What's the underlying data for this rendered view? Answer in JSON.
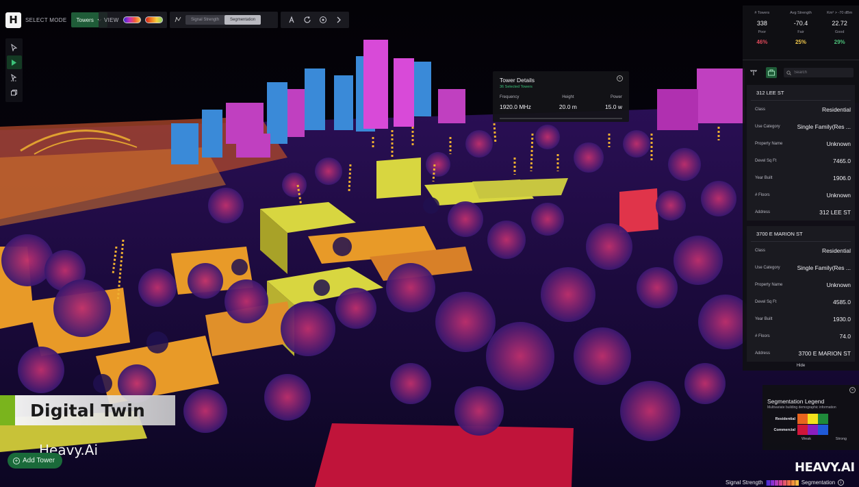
{
  "toolbar": {
    "logo_glyph": "H",
    "select_mode_label": "SELECT MODE",
    "mode_value": "Towers",
    "view_label": "VIEW",
    "segment_options": [
      "Signal Strength",
      "Segmentation"
    ],
    "segment_active": "Segmentation",
    "tool_icons": [
      "paint-brush-icon",
      "refresh-icon",
      "target-icon",
      "chevron-right-icon"
    ]
  },
  "side_tools": [
    "pointer-icon",
    "play-icon",
    "select-path-icon",
    "layers-icon"
  ],
  "tower_details": {
    "title": "Tower Details",
    "subtitle": "36 Selected Towers",
    "frequency_label": "Frequency",
    "frequency_value": "1920.0 MHz",
    "height_label": "Height",
    "height_value": "20.0 m",
    "power_label": "Power",
    "power_value": "15.0 w"
  },
  "stats": {
    "towers_label": "# Towers",
    "towers_value": "338",
    "avg_label": "Avg Strength",
    "avg_value": "-70.4",
    "km_label": "Km² > -70 dBm",
    "km_value": "22.72",
    "poor_label": "Poor",
    "poor_pct": "46%",
    "fair_label": "Fair",
    "fair_pct": "25%",
    "good_label": "Good",
    "good_pct": "29%",
    "colors": {
      "poor": "#e0495a",
      "fair": "#f2c94c",
      "good": "#4cc27a"
    }
  },
  "search": {
    "placeholder": "Search"
  },
  "cards": [
    {
      "title": "312   LEE ST",
      "class_label": "Class",
      "class_value": "Residential",
      "use_label": "Use Category",
      "use_value": "Single Family(Res ...",
      "prop_label": "Property Name",
      "prop_value": "Unknown",
      "sqft_label": "Devel Sq Ft",
      "sqft_value": "7465.0",
      "year_label": "Year Built",
      "year_value": "1906.0",
      "floors_label": "# Floors",
      "floors_value": "Unknown",
      "addr_label": "Address",
      "addr_value": "312   LEE ST"
    },
    {
      "title": "3700  E MARION ST",
      "class_label": "Class",
      "class_value": "Residential",
      "use_label": "Use Category",
      "use_value": "Single Family(Res ...",
      "prop_label": "Property Name",
      "prop_value": "Unknown",
      "sqft_label": "Devel Sq Ft",
      "sqft_value": "4585.0",
      "year_label": "Year Built",
      "year_value": "1930.0",
      "floors_label": "# Floors",
      "floors_value": "74.0",
      "addr_label": "Address",
      "addr_value": "3700  E MARION ST"
    }
  ],
  "hide_label": "Hide",
  "legend": {
    "title": "Segmentation Legend",
    "subtitle": "Multivariate building demographic information",
    "rows": [
      "Residential",
      "Commercial"
    ],
    "weak": "Weak",
    "strong": "Strong",
    "residential_colors": [
      "#e8641e",
      "#f3e21c",
      "#1f8a3a"
    ],
    "commercial_colors": [
      "#d0163a",
      "#8a1fbf",
      "#1f5ad8"
    ]
  },
  "banner": {
    "title": "Digital Twin",
    "subtitle": "Heavy.Ai"
  },
  "add_tower_label": "Add Tower",
  "brand_logo": "HEAVY.AI",
  "bottom_bar": {
    "signal_label": "Signal Strength",
    "segmentation_label": "Segmentation"
  }
}
